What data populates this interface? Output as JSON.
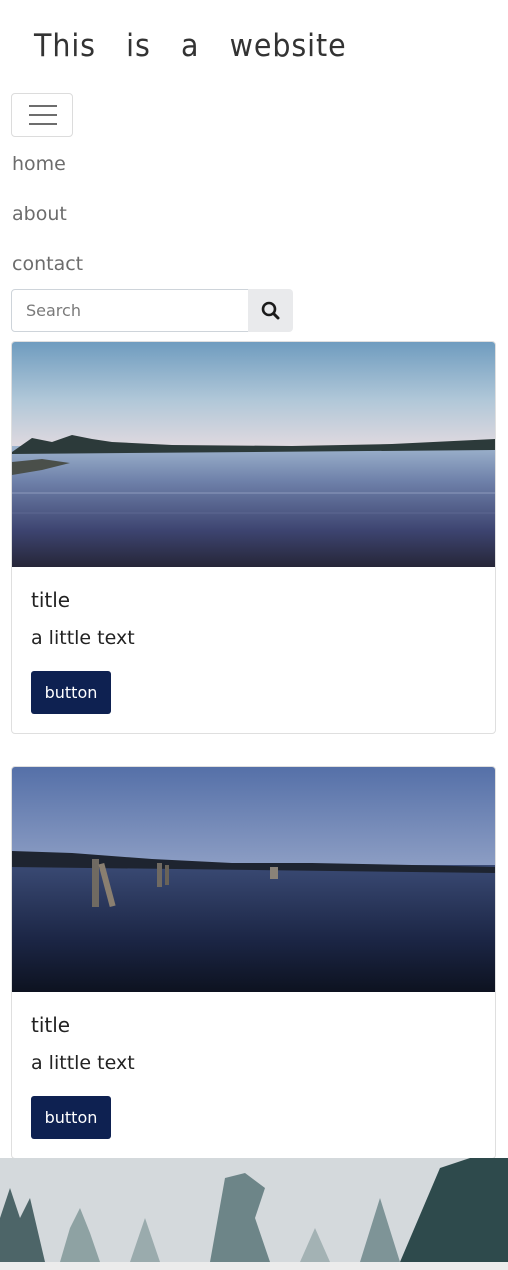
{
  "header": {
    "site_title": "This is a website"
  },
  "nav": {
    "toggler_icon": "hamburger-menu-icon",
    "links": [
      {
        "label": "home"
      },
      {
        "label": "about"
      },
      {
        "label": "contact"
      }
    ]
  },
  "search": {
    "placeholder": "Search",
    "button_icon": "search-icon"
  },
  "cards": [
    {
      "title": "title",
      "text": "a little text",
      "button_label": "button",
      "image": "lake-sunset-photo"
    },
    {
      "title": "title",
      "text": "a little text",
      "button_label": "button",
      "image": "lake-dusk-pilings-photo"
    }
  ],
  "footer": {
    "image": "misty-forest-photo"
  },
  "colors": {
    "primary_button": "#0e2151",
    "nav_text": "#6c6c6c",
    "card_border": "#dfdfdf"
  }
}
